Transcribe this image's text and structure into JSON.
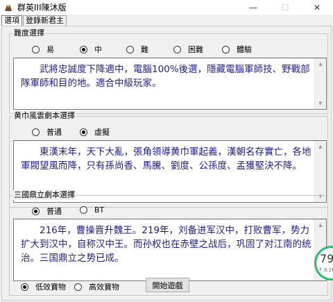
{
  "window": {
    "title": "群英III陳沐版",
    "minimize": "—",
    "maximize": "☐",
    "close": "✕"
  },
  "tabs": [
    {
      "label": "選項",
      "active": true
    },
    {
      "label": "登錄新君主",
      "active": false
    }
  ],
  "difficulty": {
    "title": "難度選擇",
    "options": [
      {
        "label": "易",
        "selected": false
      },
      {
        "label": "中",
        "selected": true
      },
      {
        "label": "難",
        "selected": false
      },
      {
        "label": "困難",
        "selected": false
      },
      {
        "label": "體驗",
        "selected": false
      }
    ],
    "description": "武將忠誠度下降適中，電腦100%後選，隱藏電腦軍師技、野戰部隊軍師和目的地。適合中級玩家。"
  },
  "yellow_turban": {
    "title": "黄巾風雲劇本選擇",
    "options": [
      {
        "label": "普通",
        "selected": false
      },
      {
        "label": "虛擬",
        "selected": true
      }
    ],
    "description": "東漢末年，天下大亂，張角領導黄巾軍起義，漢朝名存實亡，各地軍閥望風而降，只有孫尚香、馬騰、劉度、公孫度、孟獲堅決不降。"
  },
  "three_kingdoms": {
    "title": "三國鼎立劇本選擇",
    "options": [
      {
        "label": "普通",
        "selected": true
      },
      {
        "label": "BT",
        "selected": false
      }
    ],
    "description": "216年，曹操晋升魏王。219年，刘备进军汉中，打败曹军，势力扩大到汉中，自称汉中王。而孙权也在赤壁之战后，巩固了对江南的统治。三国鼎立之势已成。"
  },
  "treasure": {
    "options": [
      {
        "label": "低效寶物",
        "selected": true
      },
      {
        "label": "高效寶物",
        "selected": false
      }
    ]
  },
  "start_button": "開始遊戲",
  "speed_widget": {
    "value": "79",
    "sub": "↑ 0.1K"
  },
  "colors": {
    "desc_text": "#1a1a9c",
    "widget_ring": "#1fbf6a"
  }
}
